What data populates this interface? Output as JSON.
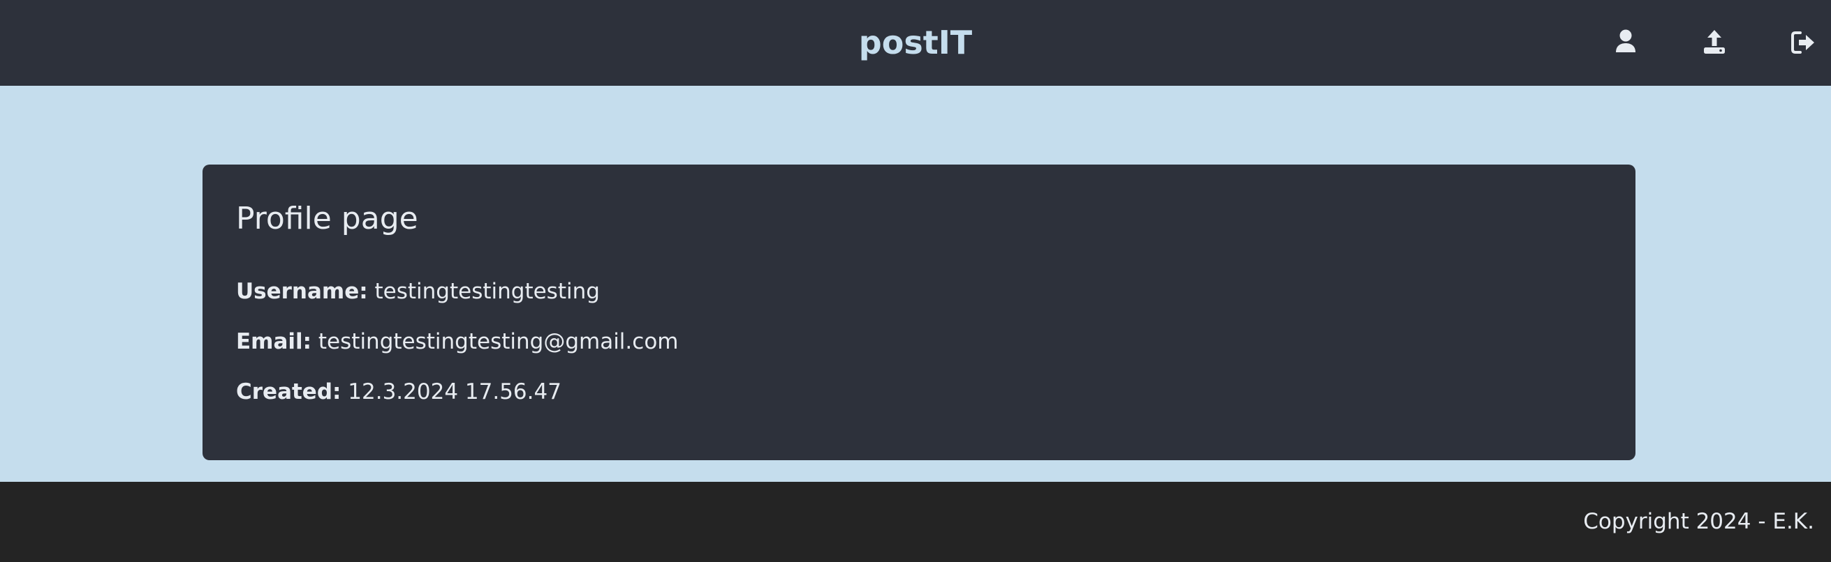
{
  "navbar": {
    "brand": "postIT",
    "icons": [
      "user-icon",
      "upload-icon",
      "logout-icon"
    ],
    "brand_color": "#c5dded",
    "background": "#2d313b"
  },
  "profile": {
    "title": "Profile page",
    "username_label": "Username:",
    "username_value": "testingtestingtesting",
    "email_label": "Email:",
    "email_value": "testingtestingtesting@gmail.com",
    "created_label": "Created:",
    "created_value": "12.3.2024 17.56.47"
  },
  "footer": {
    "copyright": "Copyright 2024 - E.K."
  },
  "colors": {
    "page_background": "#c5dded",
    "card_background": "#2d313b",
    "footer_background": "#242424",
    "text": "#e8ecf1"
  }
}
